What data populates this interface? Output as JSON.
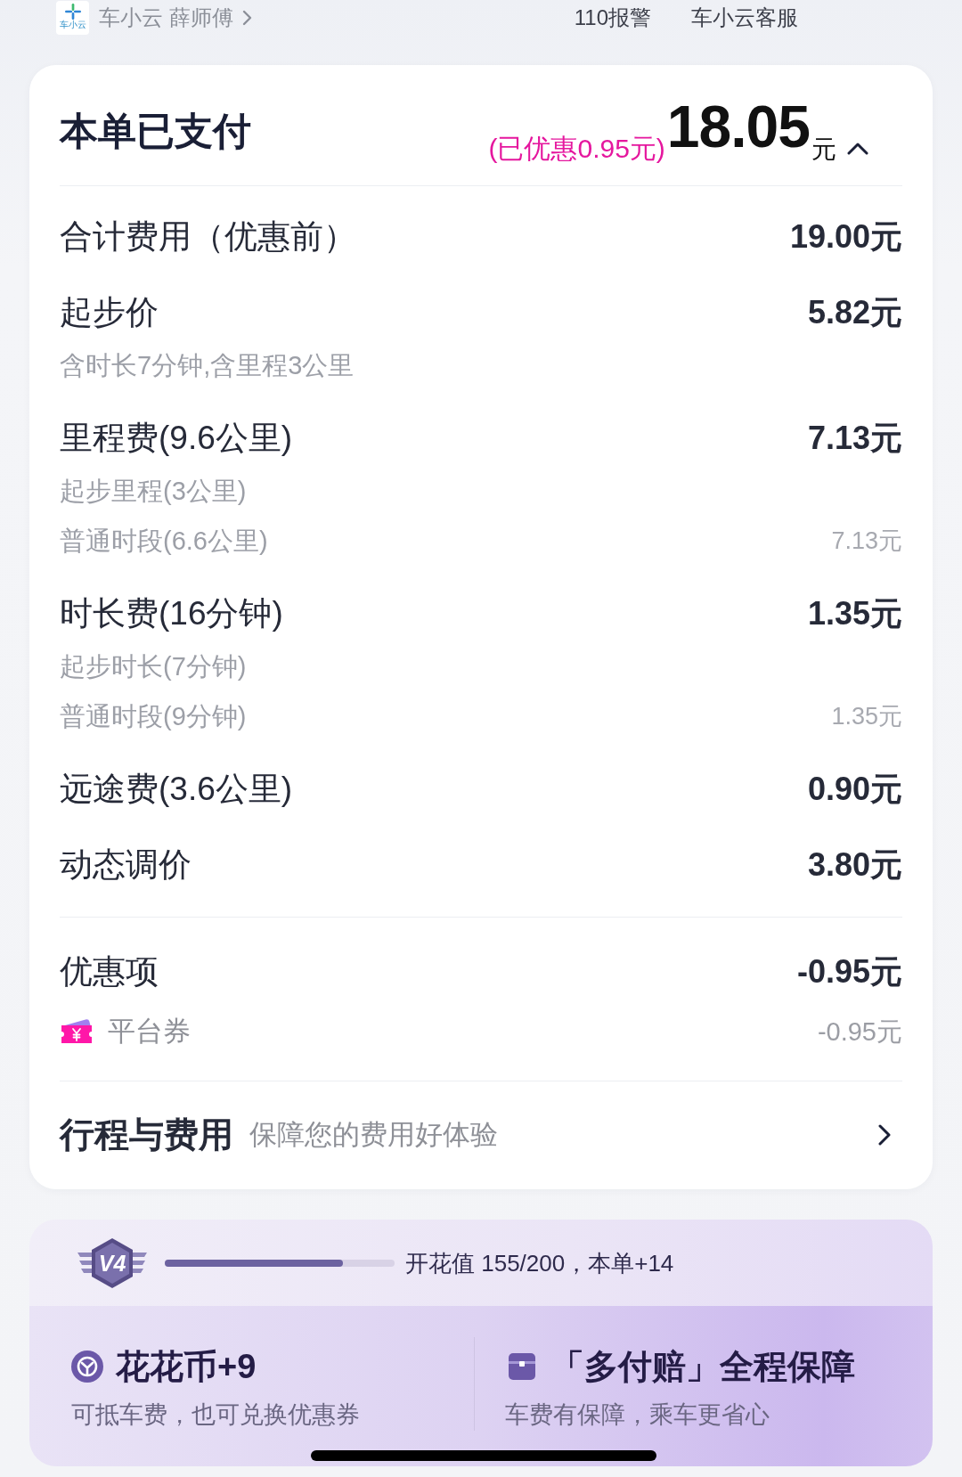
{
  "top_bar": {
    "logo_text": "车小云",
    "company": "车小云",
    "driver": "薛师傅",
    "links": [
      "110报警",
      "车小云客服"
    ]
  },
  "summary": {
    "title": "本单已支付",
    "discount_note": "(已优惠0.95元)",
    "amount": "18.05",
    "unit": "元",
    "expanded": true
  },
  "fee_items": [
    {
      "label": "合计费用（优惠前）",
      "value": "19.00元"
    },
    {
      "label": "起步价",
      "value": "5.82元",
      "details": [
        {
          "label": "含时长7分钟,含里程3公里"
        }
      ]
    },
    {
      "label": "里程费(9.6公里)",
      "value": "7.13元",
      "details": [
        {
          "label": "起步里程(3公里)"
        },
        {
          "label": "普通时段(6.6公里)",
          "value": "7.13元"
        }
      ]
    },
    {
      "label": "时长费(16分钟)",
      "value": "1.35元",
      "details": [
        {
          "label": "起步时长(7分钟)"
        },
        {
          "label": "普通时段(9分钟)",
          "value": "1.35元"
        }
      ]
    },
    {
      "label": "远途费(3.6公里)",
      "value": "0.90元"
    },
    {
      "label": "动态调价",
      "value": "3.80元"
    }
  ],
  "discount": {
    "label": "优惠项",
    "value": "-0.95元",
    "coupons": [
      {
        "label": "平台券",
        "value": "-0.95元"
      }
    ]
  },
  "trip_link": {
    "title": "行程与费用",
    "subtitle": "保障您的费用好体验"
  },
  "membership": {
    "badge": "V4",
    "level": 0.775,
    "progress_text": "开花值 155/200，本单+14"
  },
  "benefits": [
    {
      "kind": "coins",
      "title": "花花币+9",
      "subtitle": "可抵车费，也可兑换优惠券"
    },
    {
      "kind": "guarantee",
      "title": "「多付赔」全程保障",
      "subtitle": "车费有保障，乘车更省心"
    }
  ]
}
